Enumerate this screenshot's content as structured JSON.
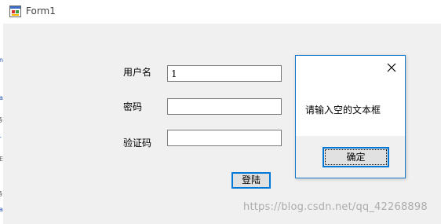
{
  "window": {
    "title": "Form1"
  },
  "form": {
    "username_label": "用户名",
    "username_value": "1",
    "password_label": "密码",
    "password_value": "",
    "captcha_label": "验证码",
    "captcha_value": "",
    "login_label": "登陆"
  },
  "message_box": {
    "text": "请输入空的文本框",
    "ok_label": "确定"
  },
  "watermark": "https://blog.csdn.net/qq_42268898",
  "left_strip_glyphs": [
    "n",
    "a",
    "§",
    "-",
    "E",
    "§",
    "a"
  ]
}
